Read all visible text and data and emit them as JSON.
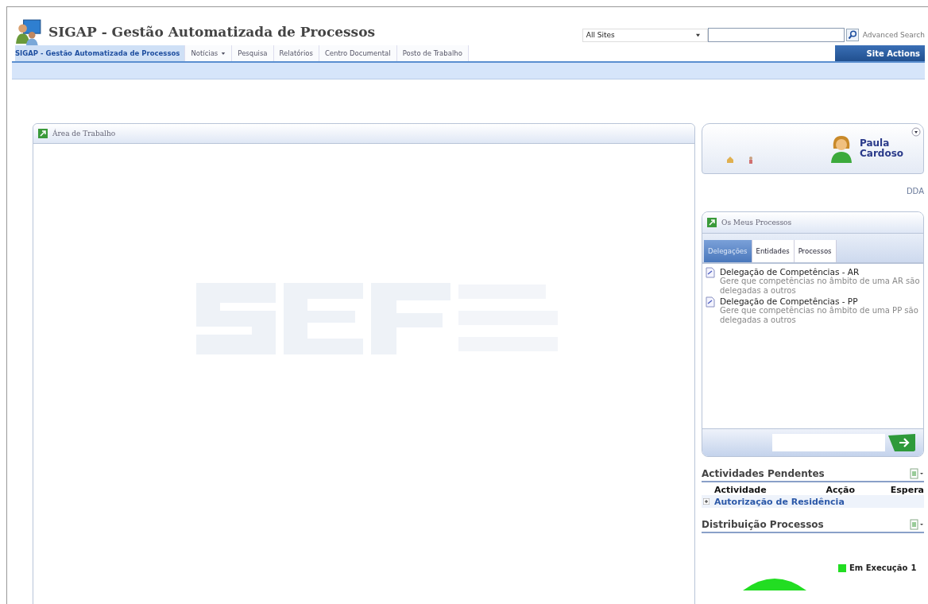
{
  "header": {
    "title": "SIGAP - Gestão Automatizada de Processos",
    "scope": "All Sites",
    "advanced_search": "Advanced Search"
  },
  "nav": {
    "items": [
      {
        "label": "SIGAP - Gestão Automatizada de Processos",
        "selected": true,
        "dropdown": false
      },
      {
        "label": "Notícias",
        "selected": false,
        "dropdown": true
      },
      {
        "label": "Pesquisa",
        "selected": false,
        "dropdown": false
      },
      {
        "label": "Relatórios",
        "selected": false,
        "dropdown": false
      },
      {
        "label": "Centro Documental",
        "selected": false,
        "dropdown": false
      },
      {
        "label": "Posto de Trabalho",
        "selected": false,
        "dropdown": false
      }
    ],
    "site_actions": "Site Actions"
  },
  "work_area": {
    "title": "Área de Trabalho"
  },
  "user_card": {
    "name": "Paula Cardoso",
    "unit": "DDA"
  },
  "my_processes": {
    "title": "Os Meus Processos",
    "tabs": [
      {
        "label": "Delegações",
        "selected": true
      },
      {
        "label": "Entidades",
        "selected": false
      },
      {
        "label": "Processos",
        "selected": false
      }
    ],
    "items": [
      {
        "title": "Delegação de Competências - AR",
        "description": "Gere que competências no âmbito de uma AR são delegadas a outros"
      },
      {
        "title": "Delegação de Competências - PP",
        "description": "Gere que competências no âmbito de uma PP são delegadas a outros"
      }
    ]
  },
  "pending": {
    "title": "Actividades Pendentes",
    "columns": [
      "Actividade",
      "Acção",
      "Espera"
    ],
    "rows": [
      {
        "label": "Autorização de Residência",
        "expanded": false
      }
    ]
  },
  "distribution": {
    "title": "Distribuição Processos",
    "legend": [
      {
        "label": "Em Execução",
        "count": "1",
        "color": "#22dd22"
      }
    ]
  }
}
